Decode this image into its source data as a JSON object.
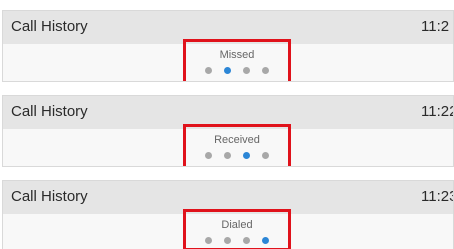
{
  "colors": {
    "active_dot": "#2c86d6",
    "inactive_dot": "#a8a8a8",
    "highlight_box": "#e0121b"
  },
  "panels": [
    {
      "title": "Call History",
      "time": "11:2",
      "view_label": "Missed",
      "active_index": 1,
      "dot_count": 4
    },
    {
      "title": "Call History",
      "time": "11:22",
      "view_label": "Received",
      "active_index": 2,
      "dot_count": 4
    },
    {
      "title": "Call History",
      "time": "11:23",
      "view_label": "Dialed",
      "active_index": 3,
      "dot_count": 4
    }
  ]
}
